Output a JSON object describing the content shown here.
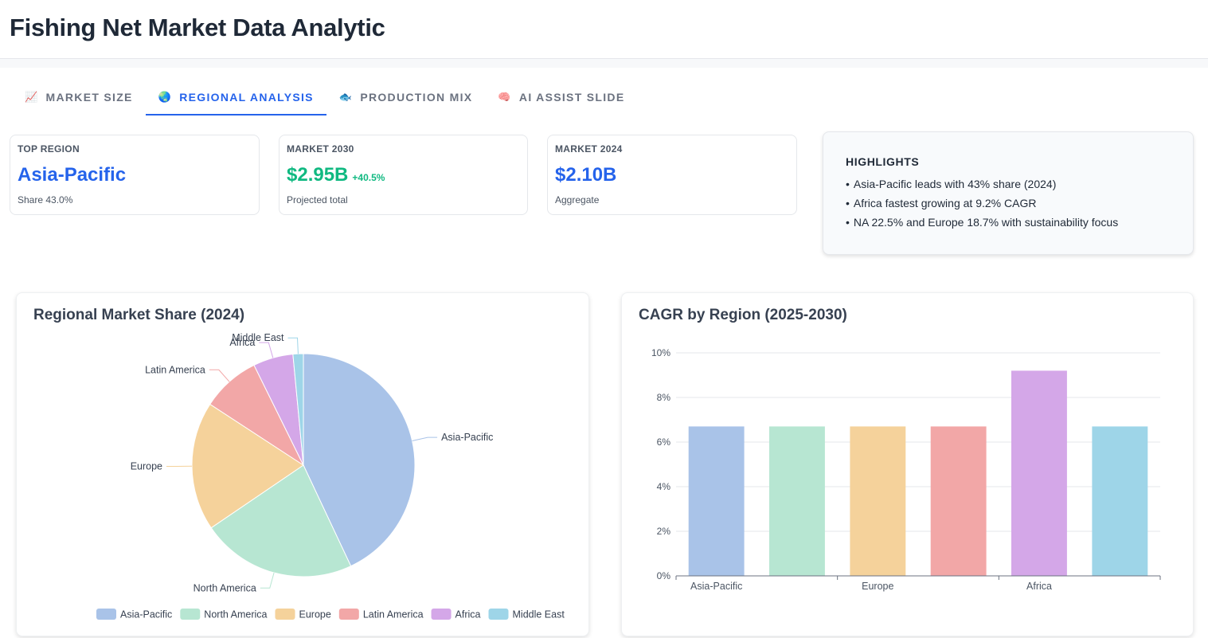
{
  "app_title": "Fishing Net Market Data Analytic",
  "tabs": [
    {
      "label": "MARKET SIZE",
      "icon": "📈",
      "active": false
    },
    {
      "label": "REGIONAL ANALYSIS",
      "icon": "🌏",
      "active": true
    },
    {
      "label": "PRODUCTION MIX",
      "icon": "🐟",
      "active": false
    },
    {
      "label": "AI ASSIST SLIDE",
      "icon": "🧠",
      "active": false
    }
  ],
  "kpis": {
    "top_region": {
      "label": "TOP REGION",
      "value": "Asia-Pacific",
      "sub": "Share 43.0%"
    },
    "market_2030": {
      "label": "MARKET 2030",
      "value": "$2.95B",
      "delta": "+40.5%",
      "sub": "Projected total"
    },
    "market_2024": {
      "label": "MARKET 2024",
      "value": "$2.10B",
      "sub": "Aggregate"
    }
  },
  "highlights": {
    "title": "HIGHLIGHTS",
    "items": [
      "Asia-Pacific leads with 43% share (2024)",
      "Africa fastest growing at 9.2% CAGR",
      "NA 22.5% and Europe 18.7% with sustainability focus"
    ]
  },
  "colors": {
    "Asia-Pacific": "#a9c3e8",
    "North America": "#b7e6d2",
    "Europe": "#f5d29b",
    "Latin America": "#f2a7a7",
    "Africa": "#d4a7e8",
    "Middle East": "#9ed5e8",
    "accent": "#2563eb",
    "positive": "#10b981"
  },
  "chart_data": [
    {
      "type": "pie",
      "title": "Regional Market Share (2024)",
      "categories": [
        "Asia-Pacific",
        "North America",
        "Europe",
        "Latin America",
        "Africa",
        "Middle East"
      ],
      "values": [
        43.0,
        22.5,
        18.7,
        8.5,
        5.8,
        1.5
      ],
      "legend": "bottom"
    },
    {
      "type": "bar",
      "title": "CAGR by Region (2025-2030)",
      "categories": [
        "Asia-Pacific",
        "North America",
        "Europe",
        "Latin America",
        "Africa",
        "Middle East"
      ],
      "values": [
        6.7,
        6.7,
        6.7,
        6.7,
        9.2,
        6.7
      ],
      "x_tick_labels": [
        "Asia-Pacific",
        "Europe",
        "Africa"
      ],
      "y_ticks": [
        "0%",
        "2%",
        "4%",
        "6%",
        "8%",
        "10%"
      ],
      "ylim": [
        0,
        10
      ],
      "grid": true
    }
  ]
}
